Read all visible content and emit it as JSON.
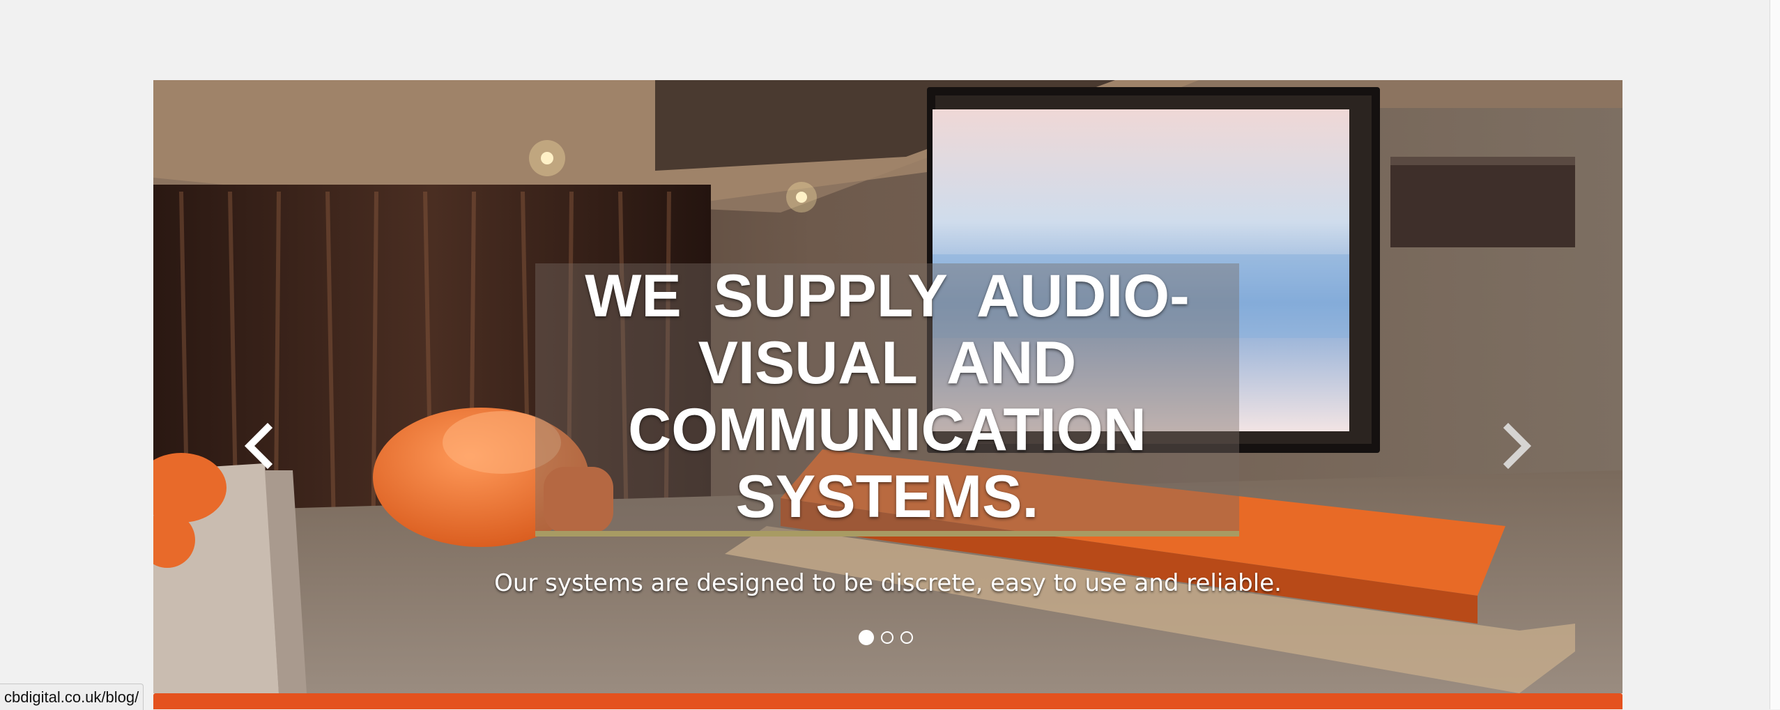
{
  "hero": {
    "caption_title": "WE SUPPLY AUDIO-VISUAL AND COMMUNICATION SYSTEMS.",
    "caption_subtitle": "Our systems are designed to be discrete, easy to use and reliable.",
    "prev_icon": "chevron-left-icon",
    "next_icon": "chevron-right-icon",
    "slide_count": 3,
    "active_slide": 1,
    "image_subject": "home-cinema-room-photo"
  },
  "status_bar": {
    "url": "cbdigital.co.uk/blog/"
  },
  "colors": {
    "page_background": "#f1f1f1",
    "accent_orange": "#e4521e",
    "caption_rule": "#a89b63",
    "caption_text": "#ffffff"
  }
}
